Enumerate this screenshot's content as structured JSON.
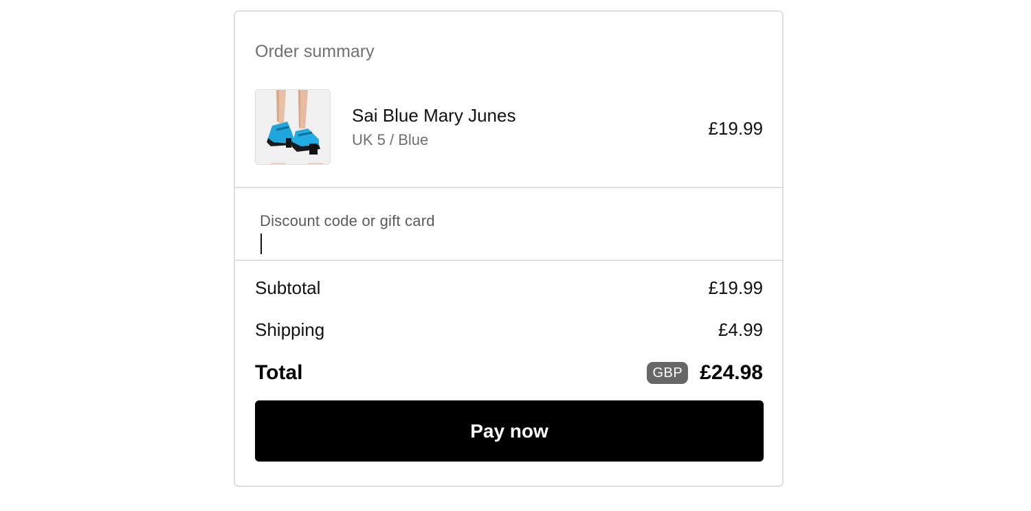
{
  "order_summary": {
    "heading": "Order summary",
    "item": {
      "name": "Sai Blue Mary Junes",
      "variant": "UK 5 / Blue",
      "price": "£19.99",
      "image_icon": "blue-mary-jane-shoes-photo"
    },
    "discount": {
      "label": "Discount code or gift card",
      "value": ""
    },
    "lines": {
      "subtotal_label": "Subtotal",
      "subtotal_value": "£19.99",
      "shipping_label": "Shipping",
      "shipping_value": "£4.99"
    },
    "total": {
      "label": "Total",
      "currency": "GBP",
      "value": "£24.98"
    },
    "pay_button_label": "Pay now"
  },
  "colors": {
    "button_bg": "#000000",
    "button_text": "#ffffff",
    "badge_bg": "#676767",
    "border": "#dedede",
    "muted_text": "#707070"
  }
}
